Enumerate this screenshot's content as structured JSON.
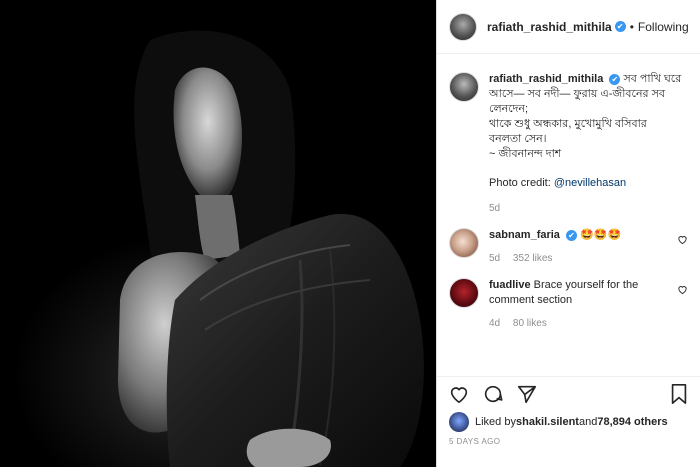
{
  "header": {
    "username": "rafiath_rashid_mithila",
    "separator": "•",
    "follow_label": "Following"
  },
  "caption": {
    "username": "rafiath_rashid_mithila",
    "lines": [
      "সব পাখি ঘরে",
      "আসে— সব নদী— ফুরায় এ-জীবনের সব",
      "লেনদেন;",
      "থাকে শুধু অন্ধকার, মুখোমুখি বসিবার",
      "বনলতা সেন।",
      "~ জীবনানন্দ দাশ"
    ],
    "credit_prefix": "Photo credit: ",
    "credit_handle": "@nevillehasan",
    "time": "5d"
  },
  "comments": [
    {
      "username": "sabnam_faria",
      "text": "🤩🤩🤩",
      "time": "5d",
      "likes": "352 likes"
    },
    {
      "username": "fuadlive",
      "text": "Brace yourself for the comment section",
      "time": "4d",
      "likes": "80 likes"
    }
  ],
  "likes": {
    "prefix": "Liked by ",
    "user": "shakil.silent",
    "middle": " and ",
    "count": "78,894 others"
  },
  "timestamp": "5 DAYS AGO",
  "icons": {
    "verified": "✔",
    "heart": "heart-icon",
    "comment": "comment-icon",
    "share": "share-icon",
    "save": "bookmark-icon"
  }
}
